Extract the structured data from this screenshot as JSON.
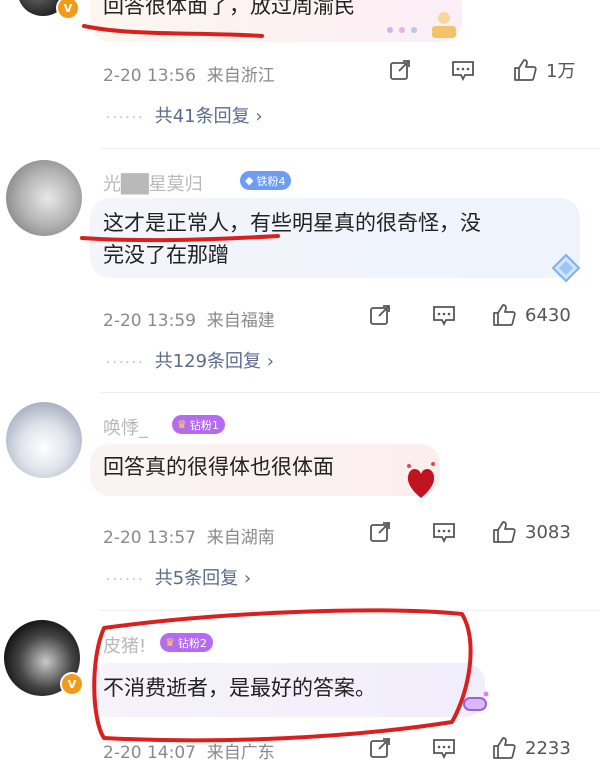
{
  "comments": [
    {
      "text": "回答很体面了，放过周渝民",
      "time": "2-20 13:56",
      "location": "来自浙江",
      "likes": "1万",
      "replies": "共41条回复"
    },
    {
      "username": "光██星莫归",
      "badge": "铁粉4",
      "text_line1": "这才是正常人，有些明星真的很奇怪，没",
      "text_line2": "完没了在那蹭",
      "time": "2-20 13:59",
      "location": "来自福建",
      "likes": "6430",
      "replies": "共129条回复"
    },
    {
      "username": "唤悸_",
      "badge": "钻粉1",
      "text": "回答真的很得体也很体面",
      "time": "2-20 13:57",
      "location": "来自湖南",
      "likes": "3083",
      "replies": "共5条回复"
    },
    {
      "username": "皮猪!",
      "badge": "钻粉2",
      "text": "不消费逝者，是最好的答案。",
      "time": "2-20 14:07",
      "location": "来自广东",
      "likes": "2233"
    }
  ],
  "icons": {
    "share": "share-icon",
    "comment": "comment-icon",
    "like": "thumbs-up-icon",
    "verified": "verified-v-icon"
  },
  "colors": {
    "reply_link": "#5b6b8c",
    "fan_badge_iron": "#6d9cf5",
    "fan_badge_diamond": "#b56bf0",
    "annotation_red": "#d9201e"
  }
}
